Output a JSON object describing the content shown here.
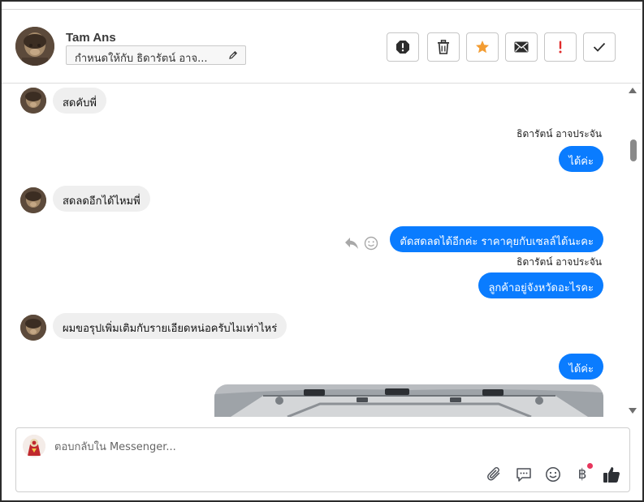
{
  "header": {
    "contact_name": "Tam Ans",
    "assign_label": "กำหนดให้กับ ธิดารัตน์ อาจ...",
    "actions": [
      {
        "name": "mark-spam-button",
        "icon": "alert-octagon-icon"
      },
      {
        "name": "delete-button",
        "icon": "trash-icon"
      },
      {
        "name": "star-button",
        "icon": "star-icon"
      },
      {
        "name": "mark-unread-button",
        "icon": "envelope-icon"
      },
      {
        "name": "follow-up-button",
        "icon": "exclamation-icon"
      },
      {
        "name": "mark-done-button",
        "icon": "check-icon"
      }
    ]
  },
  "conversation": {
    "messages": [
      {
        "direction": "incoming",
        "text": "สดคับพี่"
      },
      {
        "direction": "outgoing",
        "sender": "ธิดารัตน์ อาจประจัน",
        "text": "ได้ค่ะ"
      },
      {
        "direction": "incoming",
        "text": "สดลดอีกได้ไหมพี่"
      },
      {
        "direction": "outgoing",
        "text": "ตัดสดลดได้อีกค่ะ ราคาคุยกับเซลล์ได้นะคะ"
      },
      {
        "direction": "outgoing",
        "sender": "ธิดารัตน์ อาจประจัน",
        "text": "ลูกค้าอยู่จังหวัดอะไรคะ"
      },
      {
        "direction": "incoming",
        "text": "ผมขอรุปเพิ่มเติมกับรายเอียดหน่อครับไมเท่าไหร่"
      },
      {
        "direction": "outgoing",
        "text": "ได้ค่ะ"
      },
      {
        "direction": "outgoing",
        "attachment": "photo-of-car-part"
      }
    ]
  },
  "composer": {
    "placeholder": "ตอบกลับใน Messenger...",
    "icons": [
      "paperclip-icon",
      "speech-bubble-icon",
      "emoji-icon",
      "baht-icon",
      "thumbs-up-icon"
    ],
    "baht_symbol": "฿"
  },
  "colors": {
    "outgoing_bubble": "#0a7cff",
    "incoming_bubble": "#efefef",
    "star": "#f39c31",
    "alert_red": "#e02b2b",
    "notification_dot": "#e7355c"
  }
}
